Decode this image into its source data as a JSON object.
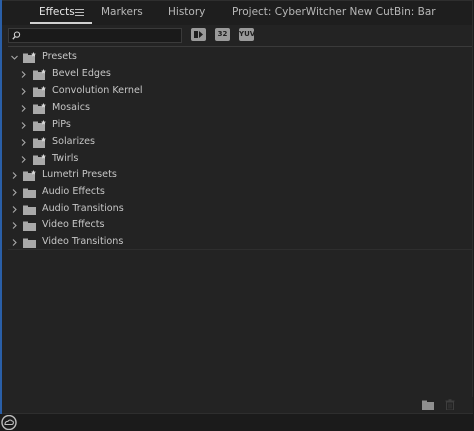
{
  "tabs": [
    {
      "label": "Effects",
      "active": true
    },
    {
      "label": "Markers",
      "active": false
    },
    {
      "label": "History",
      "active": false
    },
    {
      "label": "Project: CyberWitcher New Cut",
      "active": false
    },
    {
      "label": "Bin: Bar",
      "active": false
    }
  ],
  "search": {
    "value": "",
    "placeholder": ""
  },
  "filters": [
    {
      "label": "",
      "icon": "accelerated-effects-icon"
    },
    {
      "label": "32",
      "icon": "32-bit-color-icon"
    },
    {
      "label": "YUV",
      "icon": "yuv-effects-icon"
    }
  ],
  "tree": [
    {
      "label": "Presets",
      "expanded": true,
      "preset": true
    },
    {
      "label": "Bevel Edges",
      "expanded": false,
      "preset": true
    },
    {
      "label": "Convolution Kernel",
      "expanded": false,
      "preset": true
    },
    {
      "label": "Mosaics",
      "expanded": false,
      "preset": true
    },
    {
      "label": "PiPs",
      "expanded": false,
      "preset": true
    },
    {
      "label": "Solarizes",
      "expanded": false,
      "preset": true
    },
    {
      "label": "Twirls",
      "expanded": false,
      "preset": true
    },
    {
      "label": "Lumetri Presets",
      "expanded": false,
      "preset": true
    },
    {
      "label": "Audio Effects",
      "expanded": false,
      "preset": false
    },
    {
      "label": "Audio Transitions",
      "expanded": false,
      "preset": false
    },
    {
      "label": "Video Effects",
      "expanded": false,
      "preset": false
    },
    {
      "label": "Video Transitions",
      "expanded": false,
      "preset": false
    }
  ],
  "bottom": {
    "new_bin_icon": "new-folder-icon",
    "delete_icon": "trash-icon"
  },
  "footer": {
    "icon": "creative-cloud-icon"
  },
  "colors": {
    "panel_bg": "#232323",
    "accent": "#2a5fa8",
    "text": "#c6c6c6"
  }
}
